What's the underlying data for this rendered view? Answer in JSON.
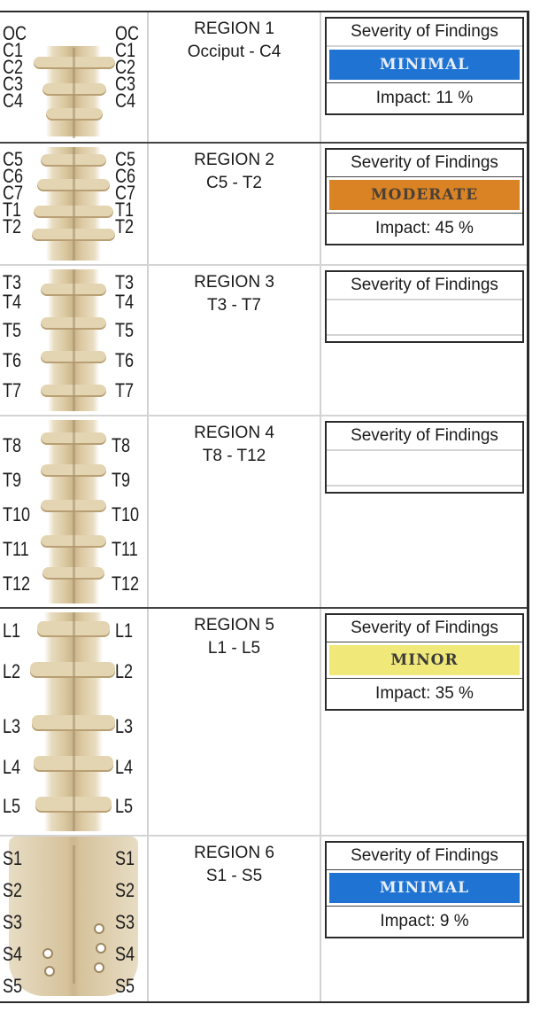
{
  "severity_heading": "Severity of Findings",
  "regions": [
    {
      "title": "REGION 1",
      "range": "Occiput - C4",
      "vertebrae": [
        "OC",
        "C1",
        "C2",
        "C3",
        "C4"
      ],
      "severity": "MINIMAL",
      "severity_bg": "#1f74d3",
      "severity_fg": "#e8eef8",
      "impact": "Impact: 11 %"
    },
    {
      "title": "REGION 2",
      "range": "C5 - T2",
      "vertebrae": [
        "C5",
        "C6",
        "C7",
        "T1",
        "T2"
      ],
      "severity": "MODERATE",
      "severity_bg": "#d98324",
      "severity_fg": "#4a4038",
      "impact": "Impact: 45 %"
    },
    {
      "title": "REGION 3",
      "range": "T3 - T7",
      "vertebrae": [
        "T3",
        "T4",
        "T5",
        "T6",
        "T7"
      ],
      "severity": "",
      "impact": ""
    },
    {
      "title": "REGION 4",
      "range": "T8 - T12",
      "vertebrae": [
        "T8",
        "T9",
        "T10",
        "T11",
        "T12"
      ],
      "severity": "",
      "impact": ""
    },
    {
      "title": "REGION 5",
      "range": "L1 - L5",
      "vertebrae": [
        "L1",
        "L2",
        "L3",
        "L4",
        "L5"
      ],
      "severity": "MINOR",
      "severity_bg": "#f0e878",
      "severity_fg": "#3b3b3b",
      "impact": "Impact: 35 %"
    },
    {
      "title": "REGION 6",
      "range": "S1 - S5",
      "vertebrae": [
        "S1",
        "S2",
        "S3",
        "S4",
        "S5"
      ],
      "severity": "MINIMAL",
      "severity_bg": "#1f74d3",
      "severity_fg": "#e8eef8",
      "impact": "Impact: 9 %"
    }
  ]
}
